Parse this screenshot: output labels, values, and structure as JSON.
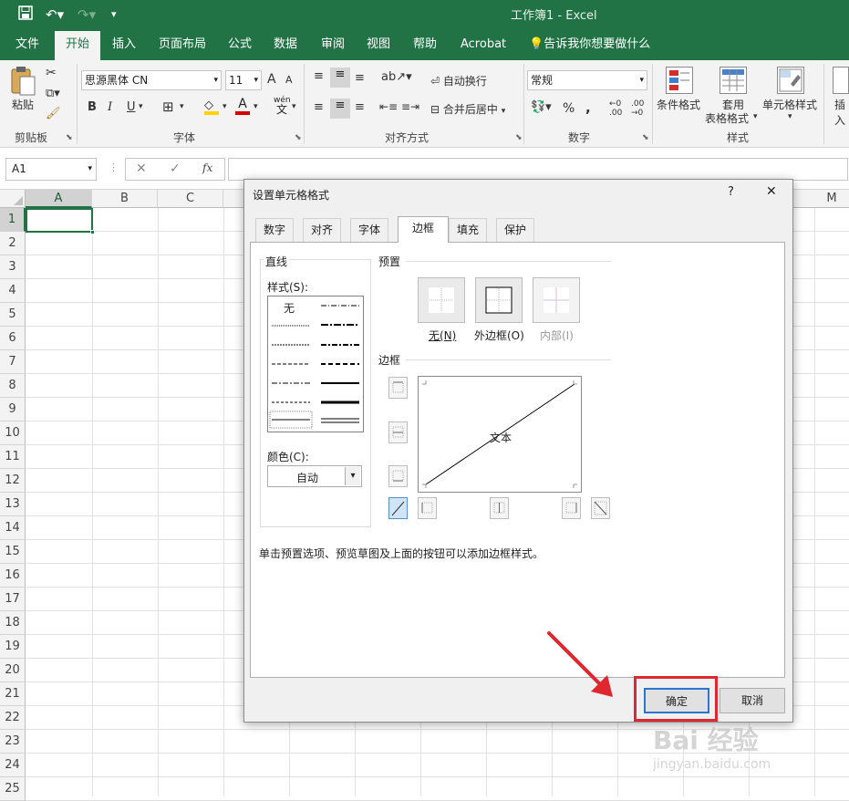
{
  "window": {
    "title": "工作簿1 - Excel"
  },
  "ribbon_tabs": [
    "文件",
    "开始",
    "插入",
    "页面布局",
    "公式",
    "数据",
    "审阅",
    "视图",
    "帮助",
    "Acrobat",
    "告诉我你想要做什么"
  ],
  "ribbon": {
    "clipboard": {
      "paste": "粘贴",
      "group": "剪贴板"
    },
    "font": {
      "name": "思源黑体 CN",
      "size": "11",
      "bold": "B",
      "italic": "I",
      "underline": "U",
      "group": "字体",
      "grow": "A",
      "shrink": "A",
      "font_color": "A",
      "phonetic_top": "wén",
      "phonetic": "文"
    },
    "alignment": {
      "wrap": "自动换行",
      "merge": "合并后居中",
      "group": "对齐方式"
    },
    "number": {
      "format": "常规",
      "percent": "%",
      "comma": ",",
      "inc": "←0 .00",
      "dec": ".00 →0",
      "group": "数字"
    },
    "styles": {
      "conditional": "条件格式",
      "table_format_1": "套用",
      "table_format_2": "表格格式",
      "cell_styles": "单元格样式",
      "group": "样式"
    },
    "cells": {
      "insert": "插入"
    }
  },
  "formula_bar": {
    "name_box": "A1",
    "fx": "fx"
  },
  "grid": {
    "columns": [
      "A",
      "B",
      "C",
      "M"
    ],
    "rows": [
      "1",
      "2",
      "3",
      "4",
      "5",
      "6",
      "7",
      "8",
      "9",
      "10",
      "11",
      "12",
      "13",
      "14",
      "15",
      "16",
      "17",
      "18",
      "19",
      "20",
      "21",
      "22",
      "23",
      "24",
      "25"
    ],
    "active_cell": "A1"
  },
  "dialog": {
    "title": "设置单元格格式",
    "help": "?",
    "close": "✕",
    "tabs": [
      "数字",
      "对齐",
      "字体",
      "边框",
      "填充",
      "保护"
    ],
    "active_tab": "边框",
    "line_section": "直线",
    "style_label": "样式(S):",
    "style_none": "无",
    "color_label": "颜色(C):",
    "color_value": "自动",
    "presets_section": "预置",
    "presets": [
      "无(N)",
      "外边框(O)",
      "内部(I)"
    ],
    "border_section": "边框",
    "preview_text": "文本",
    "hint": "单击预置选项、预览草图及上面的按钮可以添加边框样式。",
    "ok": "确定",
    "cancel": "取消"
  },
  "watermark": {
    "brand": "Bai 经验",
    "url": "jingyan.baidu.com"
  },
  "colors": {
    "excel_green": "#217346",
    "highlight_red": "#e0262e"
  }
}
